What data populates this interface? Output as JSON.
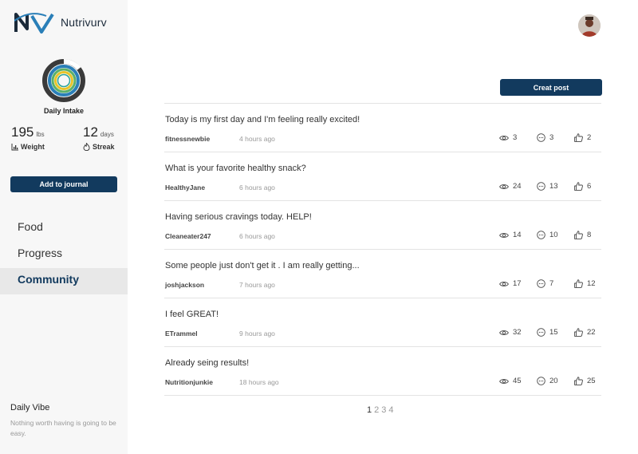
{
  "app": {
    "name": "Nutrivurv"
  },
  "colors": {
    "accent": "#123a5e",
    "ring_outer": "#3a3a3a",
    "ring_blue": "#2a7fb8",
    "ring_green": "#5bb06a",
    "ring_yellow": "#e8c42a",
    "ring_teal": "#2aa39b"
  },
  "sidebar": {
    "intake_label": "Daily Intake",
    "weight": {
      "value": "195",
      "unit": "lbs",
      "label": "Weight",
      "icon": "chart-icon"
    },
    "streak": {
      "value": "12",
      "unit": "days",
      "label": "Streak",
      "icon": "flame-icon"
    },
    "journal_button": "Add to journal",
    "nav": [
      {
        "label": "Food",
        "active": false
      },
      {
        "label": "Progress",
        "active": false
      },
      {
        "label": "Community",
        "active": true
      }
    ],
    "vibe": {
      "title": "Daily Vibe",
      "text": "Nothing worth having is going to be easy."
    }
  },
  "header": {
    "avatar_icon": "user-avatar",
    "create_button": "Creat post"
  },
  "posts": [
    {
      "title": "Today is my first day and I'm feeling really excited!",
      "user": "fitnessnewbie",
      "time": "4 hours ago",
      "views": "3",
      "comments": "3",
      "likes": "2"
    },
    {
      "title": "What is your favorite healthy snack?",
      "user": "HealthyJane",
      "time": "6 hours ago",
      "views": "24",
      "comments": "13",
      "likes": "6"
    },
    {
      "title": "Having serious cravings today. HELP!",
      "user": "Cleaneater247",
      "time": "6 hours ago",
      "views": "14",
      "comments": "10",
      "likes": "8"
    },
    {
      "title": "Some people just don't get it . I am really getting...",
      "user": "joshjackson",
      "time": "7 hours ago",
      "views": "17",
      "comments": "7",
      "likes": "12"
    },
    {
      "title": "I feel GREAT!",
      "user": "ETrammel",
      "time": "9 hours ago",
      "views": "32",
      "comments": "15",
      "likes": "22"
    },
    {
      "title": "Already seing results!",
      "user": "Nutritionjunkie",
      "time": "18 hours ago",
      "views": "45",
      "comments": "20",
      "likes": "25"
    }
  ],
  "pagination": {
    "pages": [
      "1",
      "2",
      "3",
      "4"
    ],
    "current": "1"
  }
}
